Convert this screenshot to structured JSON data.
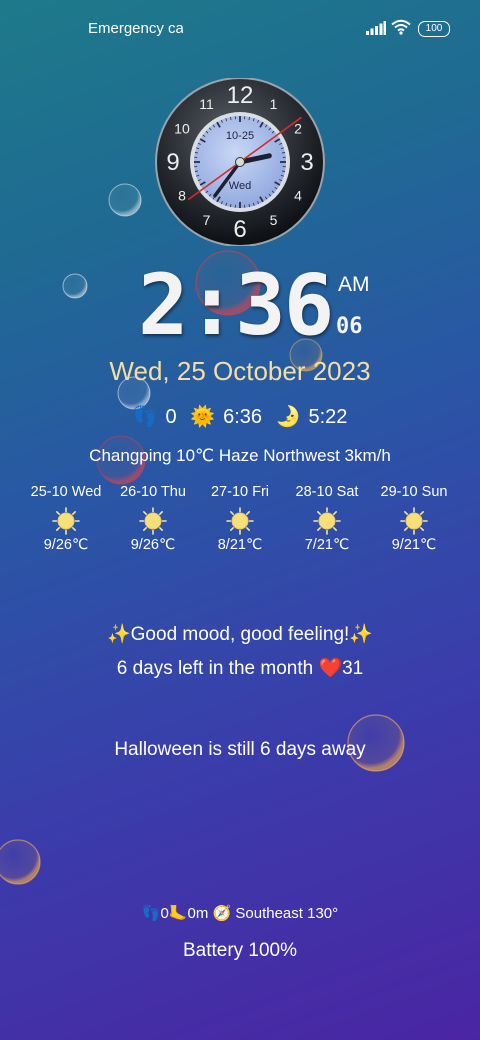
{
  "status_bar": {
    "carrier": "Emergency ca",
    "battery": "100"
  },
  "analog_clock": {
    "date_label": "10-25",
    "weekday_label": "Wed",
    "numerals": [
      "12",
      "1",
      "2",
      "3",
      "4",
      "5",
      "6",
      "7",
      "8",
      "9",
      "10",
      "11"
    ],
    "hour": 2,
    "minute": 36,
    "second": 6
  },
  "digital_clock": {
    "time": "2:36",
    "ampm": "AM",
    "seconds": "06"
  },
  "date": "Wed, 25 October 2023",
  "sun_row": {
    "steps_icon": "👣",
    "steps": "0",
    "sunrise_icon": "🌞",
    "sunrise": "6:36",
    "moon_icon": "🌛",
    "sunset": "5:22"
  },
  "weather_line": "Changping 10℃ Haze Northwest 3km/h",
  "forecast": [
    {
      "day": "25-10 Wed",
      "temp": "9/26℃",
      "icon": "sun-icon"
    },
    {
      "day": "26-10 Thu",
      "temp": "9/26℃",
      "icon": "sun-icon"
    },
    {
      "day": "27-10 Fri",
      "temp": "8/21℃",
      "icon": "sun-icon"
    },
    {
      "day": "28-10 Sat",
      "temp": "7/21℃",
      "icon": "sun-icon"
    },
    {
      "day": "29-10 Sun",
      "temp": "9/21℃",
      "icon": "sun-icon"
    }
  ],
  "mood": "✨Good mood, good feeling!✨",
  "month_left": "6 days left in the month ❤️31",
  "halloween": "Halloween is still 6 days away",
  "bottom_row": "👣0🦶0m 🧭 Southeast 130°",
  "battery_text": "Battery 100%",
  "colors": {
    "date_text": "#f4dfa0",
    "second_hand": "#d82a2a"
  }
}
